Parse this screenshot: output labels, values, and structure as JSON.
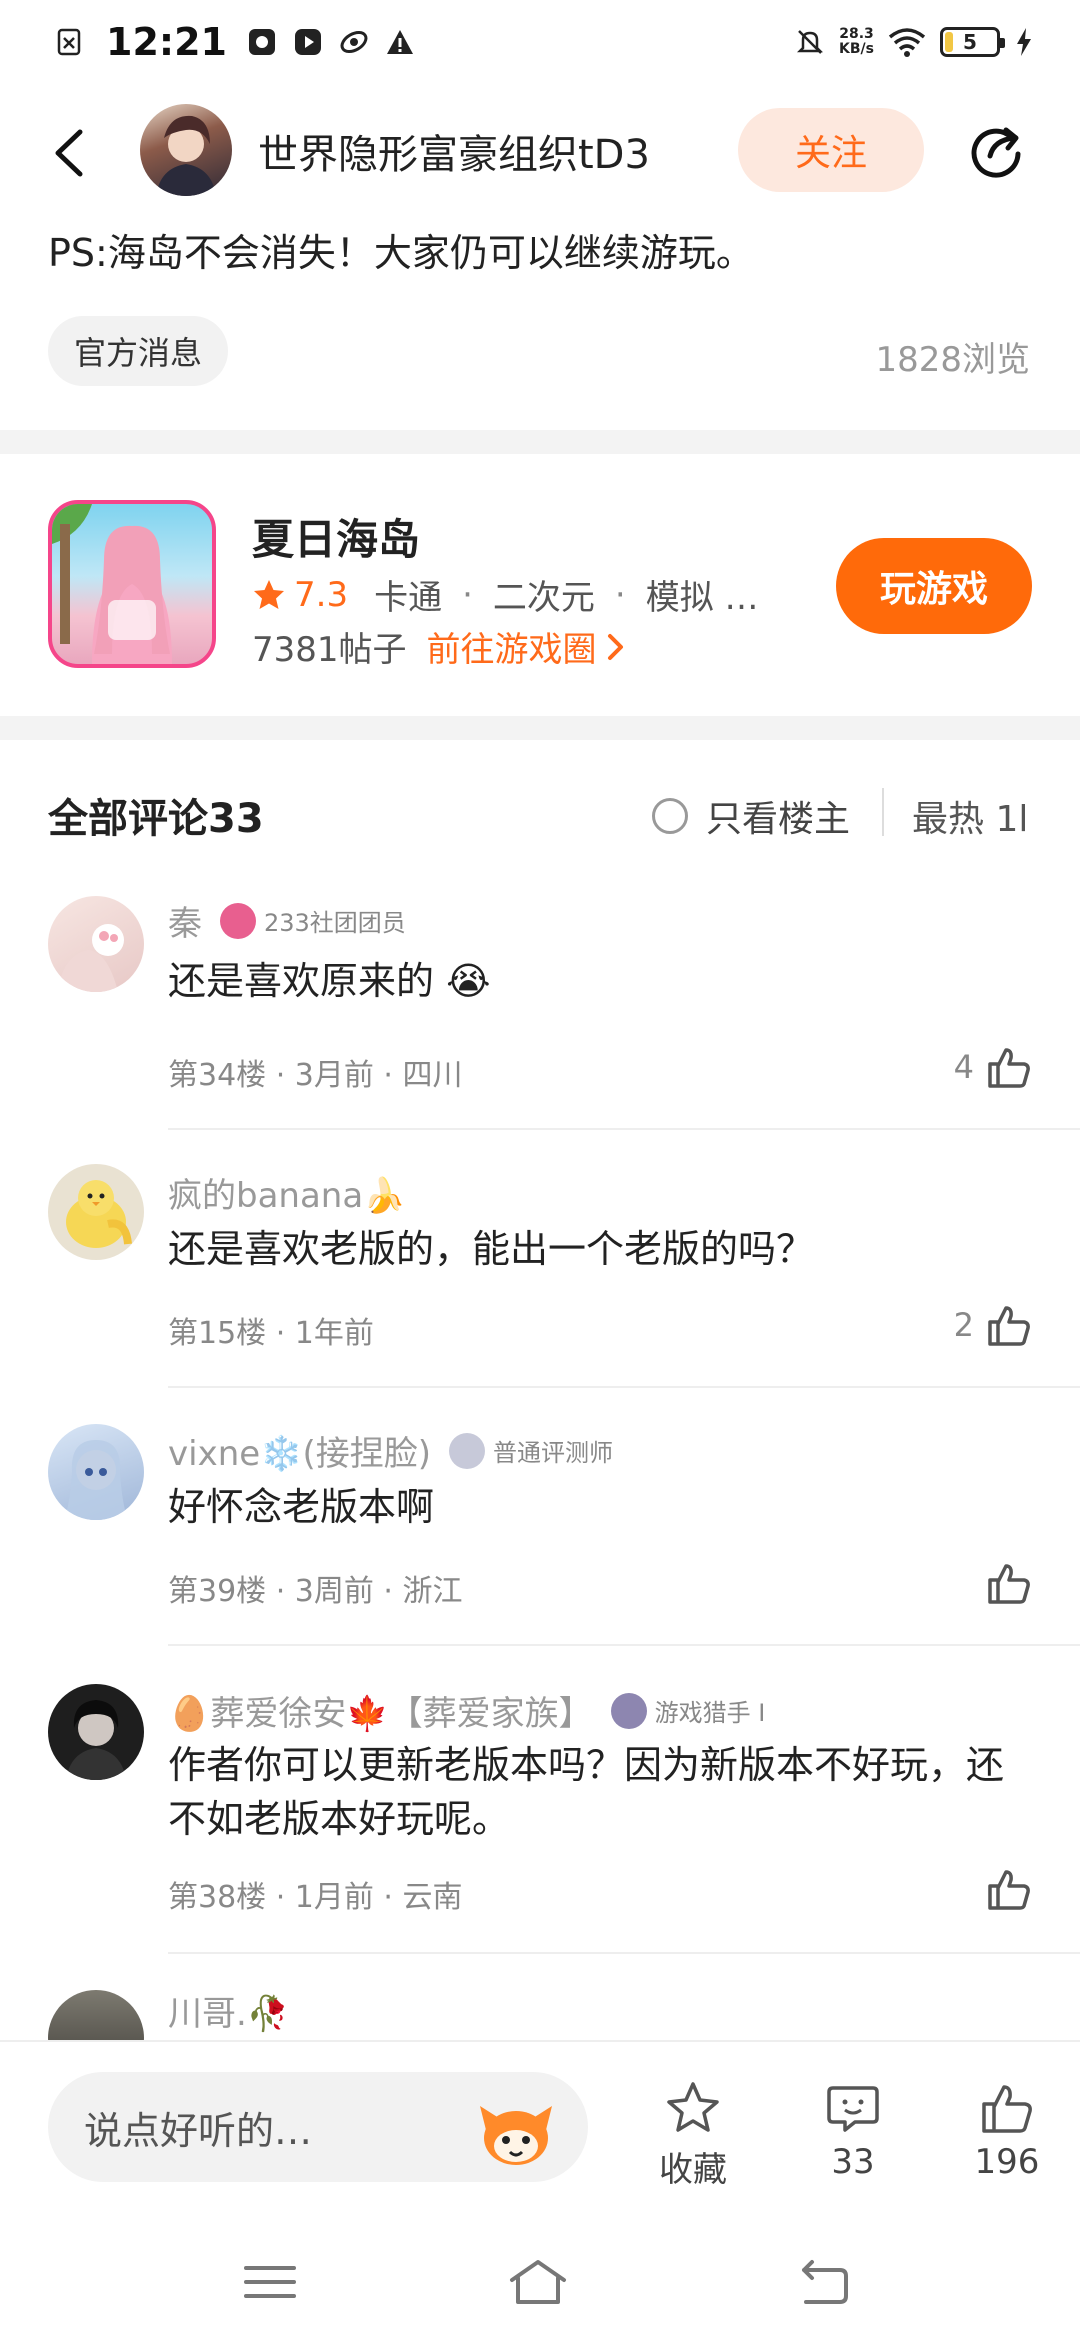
{
  "status_bar": {
    "time": "12:21",
    "net_speed_value": "28.3",
    "net_speed_unit": "KB/s",
    "battery": "5"
  },
  "header": {
    "author_name": "世界隐形富豪组织tD3",
    "follow_label": "关注"
  },
  "post": {
    "text": "PS:海岛不会消失！大家仍可以继续游玩。",
    "tag": "官方消息",
    "views": "1828浏览"
  },
  "game": {
    "title": "夏日海岛",
    "rating": "7.3",
    "genres": [
      "卡通",
      "二次元",
      "模拟 …"
    ],
    "posts": "7381帖子",
    "circle_link": "前往游戏圈",
    "play_label": "玩游戏"
  },
  "comments_header": {
    "title": "全部评论33",
    "owner_only": "只看楼主",
    "sort": "最热 1l"
  },
  "comments": [
    {
      "name": "秦",
      "badge": "233社团团员",
      "text": "还是喜欢原来的 😭",
      "meta": "第34楼 · 3月前 · 四川",
      "likes": "4"
    },
    {
      "name": "疯的banana🍌",
      "badge": "",
      "text": "还是喜欢老版的，能出一个老版的吗？",
      "meta": "第15楼 · 1年前",
      "likes": "2"
    },
    {
      "name": "vixne❄️(接捏脸)",
      "badge": "普通评测师",
      "text": "好怀念老版本啊",
      "meta": "第39楼 · 3周前 · 浙江",
      "likes": ""
    },
    {
      "name": "🥚葬爱徐安🍁【葬爱家族】",
      "badge": "游戏猎手 I",
      "text": "作者你可以更新老版本吗？因为新版本不好玩，还不如老版本好玩呢。",
      "meta": "第38楼 · 1月前 · 云南",
      "likes": ""
    },
    {
      "name": "川哥.🥀",
      "badge": "",
      "text": "",
      "meta": "",
      "likes": ""
    }
  ],
  "bottom_bar": {
    "input_placeholder": "说点好听的…",
    "favorite_label": "收藏",
    "comment_count": "33",
    "like_count": "196"
  },
  "colors": {
    "accent": "#ff6a0a",
    "follow_bg": "#fde8de"
  }
}
